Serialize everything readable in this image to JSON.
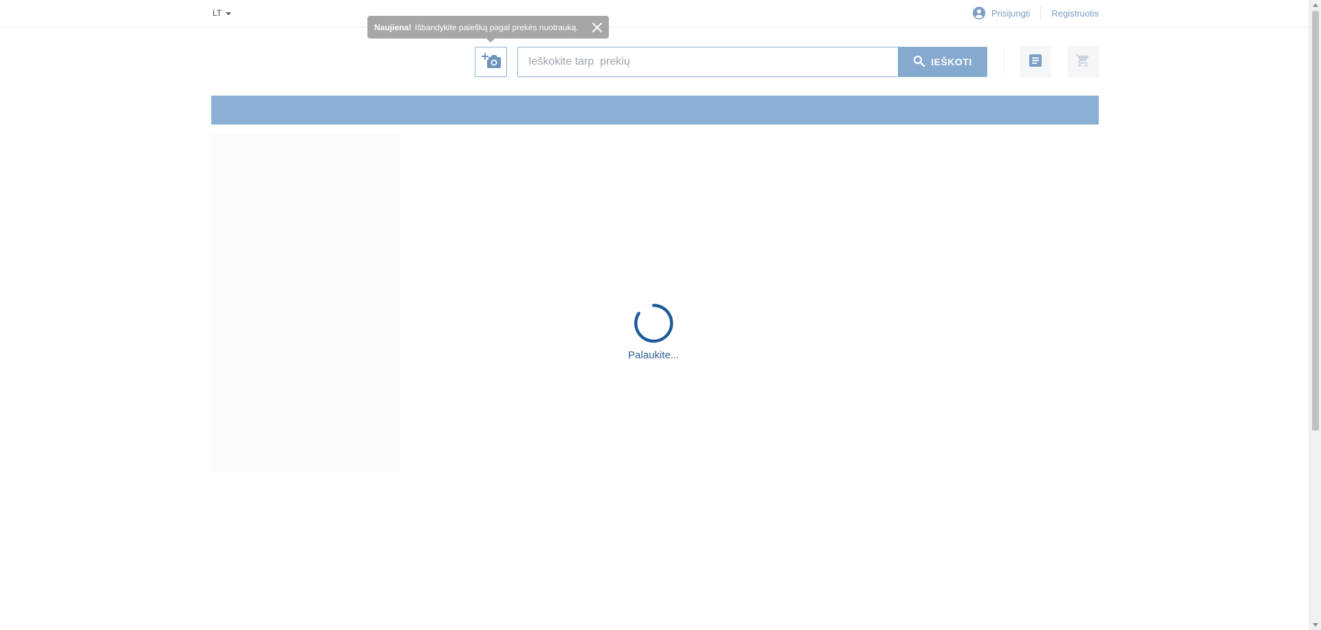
{
  "header": {
    "language": "LT",
    "login_label": "Prisijungti",
    "register_label": "Registruotis"
  },
  "tooltip": {
    "bold_text": "Naujiena!",
    "message": "Išbandykite paiešką pagal prekės nuotrauką."
  },
  "search": {
    "placeholder": "Ieškokite tarp  prekių",
    "value": "",
    "button_label": "IEŠKOTI"
  },
  "icons": {
    "camera": "add-photo-icon",
    "search": "search-icon",
    "list": "document-list-icon",
    "cart": "cart-icon",
    "user": "account-circle-icon",
    "close": "close-icon"
  },
  "loader": {
    "text": "Palaukite..."
  },
  "colors": {
    "accent": "#8ab0d5",
    "button": "#86a9cf",
    "border": "#8aafd4",
    "spinner": "#1f5a9a",
    "link": "#7b9ec4"
  }
}
